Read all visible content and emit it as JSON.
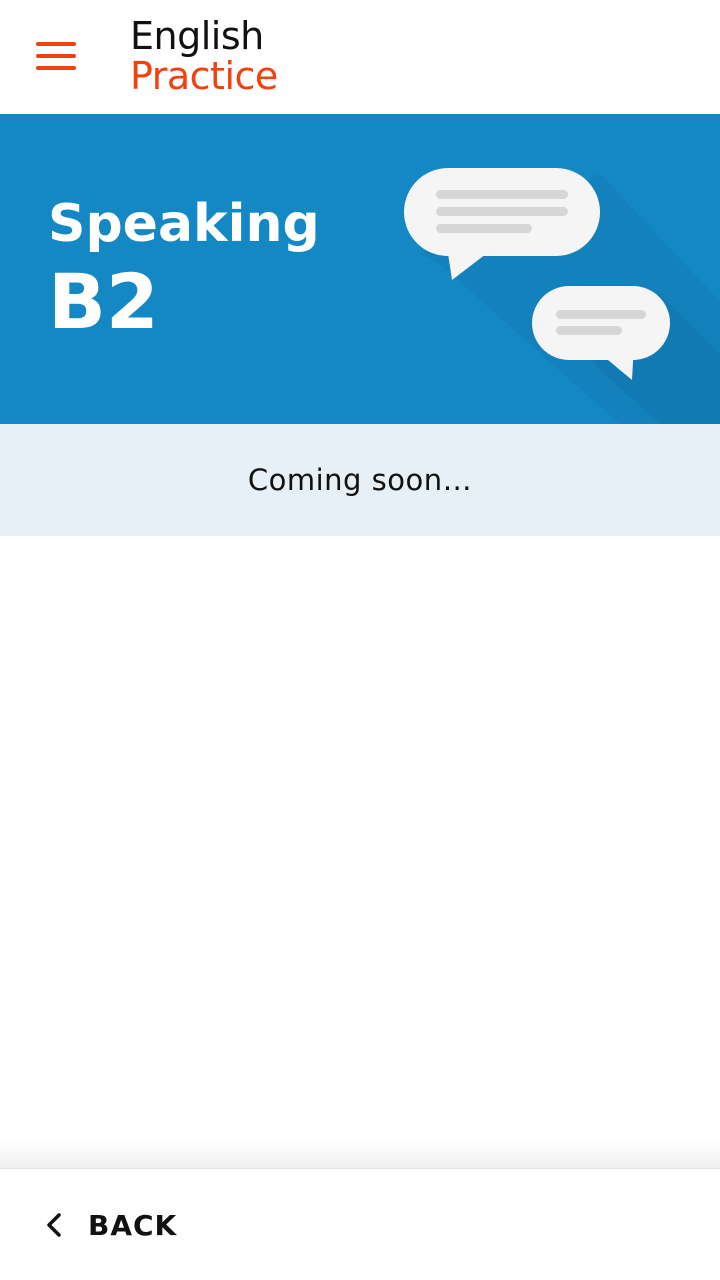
{
  "header": {
    "logo_line1": "English",
    "logo_line2": "Practice",
    "menu_icon": "hamburger-menu-icon",
    "accent_color": "#f0420f"
  },
  "banner": {
    "title": "Speaking",
    "level": "B2",
    "background_color": "#1487c5",
    "illustration_icon": "speech-bubbles-icon"
  },
  "notice": {
    "text": "Coming soon…"
  },
  "footer": {
    "back_label": "BACK",
    "back_icon": "chevron-left-icon"
  }
}
